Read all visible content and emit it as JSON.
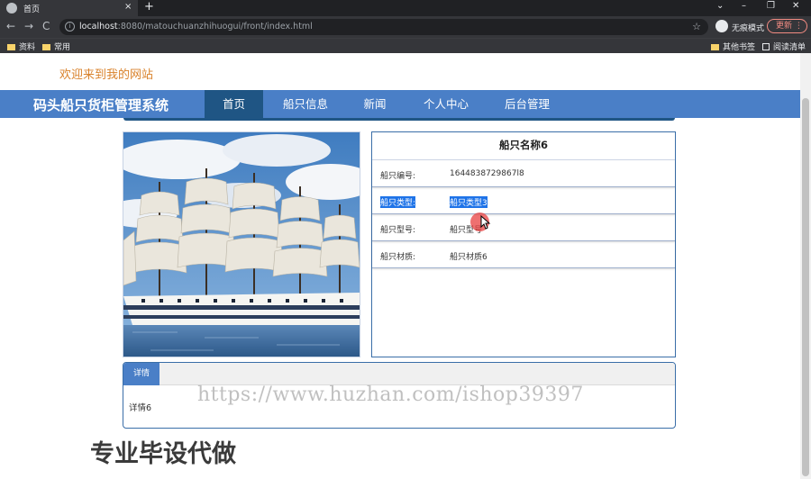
{
  "browser": {
    "tab_title": "首页",
    "tab_close": "×",
    "new_tab": "+",
    "window_controls": [
      "⌄",
      "–",
      "❐",
      "✕"
    ],
    "nav": {
      "back": "←",
      "forward": "→",
      "reload": "C"
    },
    "url_host": "localhost",
    "url_rest": ":8080/matouchuanzhihuogui/front/index.html",
    "incognito_label": "无痕模式",
    "update_label": "更新",
    "bookmarks": [
      "资料",
      "常用"
    ],
    "bookmarks_right": [
      "其他书签",
      "阅读清单"
    ]
  },
  "site": {
    "welcome": "欢迎来到我的网站",
    "brand": "码头船只货柜管理系统",
    "nav": [
      "首页",
      "船只信息",
      "新闻",
      "个人中心",
      "后台管理"
    ],
    "active_nav": "首页"
  },
  "ship": {
    "name": "船只名称6",
    "fields": [
      {
        "label": "船只编号:",
        "value": "1644838729867l8"
      },
      {
        "label": "船只类型:",
        "value": "船只类型3"
      },
      {
        "label": "船只型号:",
        "value": "船只型号"
      },
      {
        "label": "船只材质:",
        "value": "船只材质6"
      }
    ]
  },
  "detail": {
    "tab_label": "详情",
    "content": "详情6"
  },
  "overlay": {
    "watermark": "https://www.huzhan.com/ishop39397",
    "promo": "专业毕设代做"
  },
  "colors": {
    "nav_bg": "#4a7fc7",
    "nav_active": "#1f5584",
    "welcome": "#d9822b",
    "selection": "#1e73e8"
  }
}
